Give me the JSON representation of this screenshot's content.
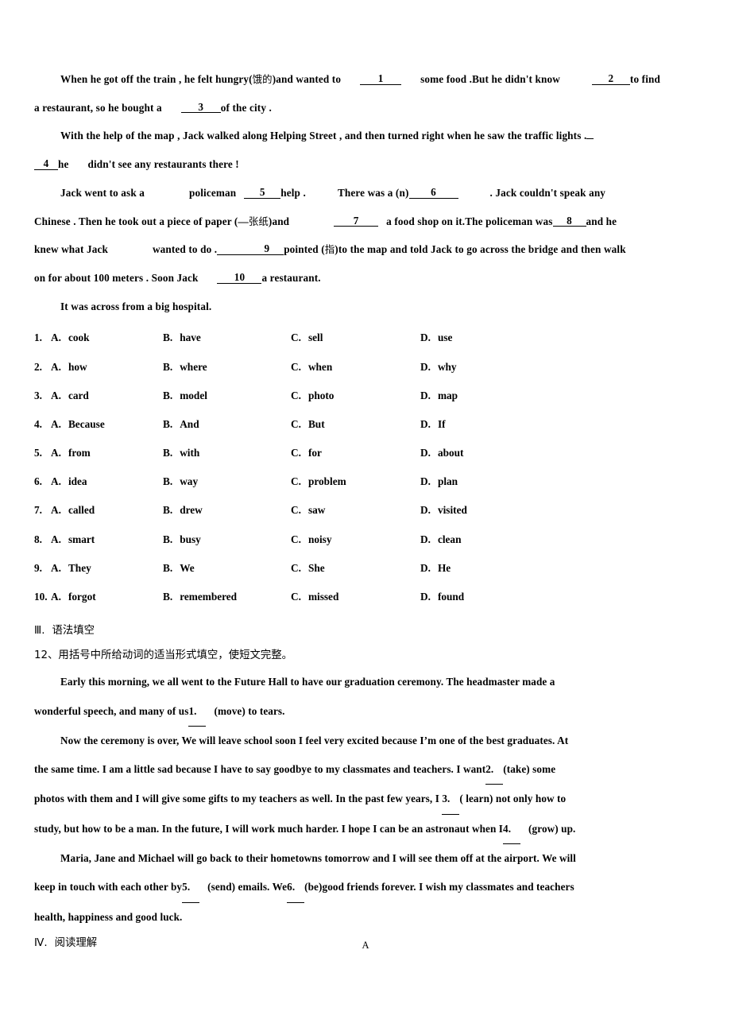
{
  "document": {
    "cloze_passage": {
      "lines": [
        {
          "id": "p1l1",
          "segments": [
            {
              "type": "indent"
            },
            {
              "type": "text",
              "value": "When he got off the train , he felt hungry("
            },
            {
              "type": "cjk",
              "value": "饿的"
            },
            {
              "type": "text",
              "value": ")and wanted to"
            },
            {
              "type": "gap",
              "size": "md"
            },
            {
              "type": "blank",
              "w": "w1",
              "value": "1"
            },
            {
              "type": "gap",
              "size": "md"
            },
            {
              "type": "text",
              "value": "some food .But he didn't know"
            },
            {
              "type": "gap",
              "size": "lg"
            },
            {
              "type": "blank",
              "w": "w2",
              "value": "2"
            },
            {
              "type": "text",
              "value": "to find"
            }
          ]
        },
        {
          "id": "p1l2",
          "segments": [
            {
              "type": "text",
              "value": "a restaurant, so he bought a"
            },
            {
              "type": "gap",
              "size": "md"
            },
            {
              "type": "blank",
              "w": "w3",
              "value": "3"
            },
            {
              "type": "text",
              "value": "of the city ."
            }
          ]
        },
        {
          "id": "p2l1",
          "segments": [
            {
              "type": "indent"
            },
            {
              "type": "text",
              "value": "With the help of the map , Jack walked along Helping Street , and then turned right when he saw the traffic lights ."
            },
            {
              "type": "tinyblank"
            }
          ]
        },
        {
          "id": "p2l2",
          "segments": [
            {
              "type": "blank",
              "w": "w4",
              "value": "4"
            },
            {
              "type": "text",
              "value": "he"
            },
            {
              "type": "gap",
              "size": "md"
            },
            {
              "type": "text",
              "value": "didn't see any restaurants there !"
            }
          ]
        },
        {
          "id": "p3l1",
          "segments": [
            {
              "type": "indent"
            },
            {
              "type": "text",
              "value": "Jack went to ask a"
            },
            {
              "type": "gap",
              "size": "xl"
            },
            {
              "type": "text",
              "value": "policeman"
            },
            {
              "type": "gap",
              "size": "sm"
            },
            {
              "type": "blank",
              "w": "w5",
              "value": "5"
            },
            {
              "type": "text",
              "value": "help ."
            },
            {
              "type": "gap",
              "size": "lg"
            },
            {
              "type": "text",
              "value": "There was a (n)"
            },
            {
              "type": "blank",
              "w": "w6",
              "value": "6"
            },
            {
              "type": "gap",
              "size": "lg"
            },
            {
              "type": "text",
              "value": ". Jack couldn't speak any"
            }
          ]
        },
        {
          "id": "p3l2",
          "segments": [
            {
              "type": "text",
              "value": "Chinese . Then he took out a piece of paper (—"
            },
            {
              "type": "cjk",
              "value": "张纸"
            },
            {
              "type": "text",
              "value": ")and"
            },
            {
              "type": "gap",
              "size": "xl"
            },
            {
              "type": "blank",
              "w": "w7",
              "value": "7"
            },
            {
              "type": "gap",
              "size": "sm"
            },
            {
              "type": "text",
              "value": "a food shop on it.The policeman was"
            },
            {
              "type": "blank",
              "w": "w8",
              "value": "8"
            },
            {
              "type": "text",
              "value": "and he"
            }
          ]
        },
        {
          "id": "p3l3",
          "segments": [
            {
              "type": "text",
              "value": "knew what Jack"
            },
            {
              "type": "gap",
              "size": "xl"
            },
            {
              "type": "text",
              "value": "wanted to do ."
            },
            {
              "type": "blank",
              "w": "w9",
              "value": "9"
            },
            {
              "type": "text",
              "value": "pointed ("
            },
            {
              "type": "cjk",
              "value": "指"
            },
            {
              "type": "text",
              "value": ")to the map and told Jack to go across the bridge and then walk"
            }
          ]
        },
        {
          "id": "p3l4",
          "segments": [
            {
              "type": "text",
              "value": "on for about 100 meters . Soon Jack"
            },
            {
              "type": "gap",
              "size": "md"
            },
            {
              "type": "blank",
              "w": "w10",
              "value": "10"
            },
            {
              "type": "text",
              "value": "a restaurant."
            }
          ]
        },
        {
          "id": "p4l1",
          "segments": [
            {
              "type": "indent"
            },
            {
              "type": "text",
              "value": "It was across from a big hospital."
            }
          ]
        }
      ]
    },
    "choices": [
      {
        "num": "1.",
        "options": [
          {
            "letter": "A.",
            "text": "cook"
          },
          {
            "letter": "B.",
            "text": "have"
          },
          {
            "letter": "C.",
            "text": "sell"
          },
          {
            "letter": "D.",
            "text": "use"
          }
        ]
      },
      {
        "num": "2.",
        "options": [
          {
            "letter": "A.",
            "text": "how"
          },
          {
            "letter": "B.",
            "text": "where"
          },
          {
            "letter": "C.",
            "text": "when"
          },
          {
            "letter": "D.",
            "text": "why"
          }
        ]
      },
      {
        "num": "3.",
        "options": [
          {
            "letter": "A.",
            "text": "card"
          },
          {
            "letter": "B.",
            "text": "model"
          },
          {
            "letter": "C.",
            "text": "photo"
          },
          {
            "letter": "D.",
            "text": "map"
          }
        ]
      },
      {
        "num": "4.",
        "options": [
          {
            "letter": "A.",
            "text": "Because"
          },
          {
            "letter": "B.",
            "text": "And"
          },
          {
            "letter": "C.",
            "text": "But"
          },
          {
            "letter": "D.",
            "text": "If"
          }
        ]
      },
      {
        "num": "5.",
        "options": [
          {
            "letter": "A.",
            "text": "from"
          },
          {
            "letter": "B.",
            "text": "with"
          },
          {
            "letter": "C.",
            "text": "for"
          },
          {
            "letter": "D.",
            "text": "about"
          }
        ]
      },
      {
        "num": "6.",
        "options": [
          {
            "letter": "A.",
            "text": "idea"
          },
          {
            "letter": "B.",
            "text": "way"
          },
          {
            "letter": "C.",
            "text": "problem"
          },
          {
            "letter": "D.",
            "text": "plan"
          }
        ]
      },
      {
        "num": "7.",
        "options": [
          {
            "letter": "A.",
            "text": "called"
          },
          {
            "letter": "B.",
            "text": "drew"
          },
          {
            "letter": "C.",
            "text": "saw"
          },
          {
            "letter": "D.",
            "text": "visited"
          }
        ]
      },
      {
        "num": "8.",
        "options": [
          {
            "letter": "A.",
            "text": "smart"
          },
          {
            "letter": "B.",
            "text": "busy"
          },
          {
            "letter": "C.",
            "text": "noisy"
          },
          {
            "letter": "D.",
            "text": "clean"
          }
        ]
      },
      {
        "num": "9.",
        "options": [
          {
            "letter": "A.",
            "text": "They"
          },
          {
            "letter": "B.",
            "text": "We"
          },
          {
            "letter": "C.",
            "text": "She"
          },
          {
            "letter": "D.",
            "text": "He"
          }
        ]
      },
      {
        "num": "10.",
        "options": [
          {
            "letter": "A.",
            "text": "forgot"
          },
          {
            "letter": "B.",
            "text": "remembered"
          },
          {
            "letter": "C.",
            "text": "missed"
          },
          {
            "letter": "D.",
            "text": "found"
          }
        ]
      }
    ],
    "section_grammar": {
      "roman": "Ⅲ.",
      "title": "语法填空",
      "instruction": "12、用括号中所给动词的适当形式填空，使短文完整。",
      "lines": [
        {
          "id": "g1l1",
          "segments": [
            {
              "type": "indent"
            },
            {
              "type": "text",
              "value": "Early this morning, we all went to the Future Hall to have our graduation ceremony. The headmaster made a"
            }
          ]
        },
        {
          "id": "g1l2",
          "segments": [
            {
              "type": "text",
              "value": "wonderful speech, and many of us"
            },
            {
              "type": "gblank",
              "value": "1."
            },
            {
              "type": "gap",
              "size": "sm"
            },
            {
              "type": "text",
              "value": "(move) to tears."
            }
          ]
        },
        {
          "id": "g2l1",
          "segments": [
            {
              "type": "indent"
            },
            {
              "type": "text",
              "value": "Now the ceremony is over, We will leave school soon I feel very excited because I’m one of the best graduates. At"
            }
          ]
        },
        {
          "id": "g2l2",
          "segments": [
            {
              "type": "text",
              "value": "the same time. I am a little sad because I have to say goodbye to my classmates and teachers. I want"
            },
            {
              "type": "gblank",
              "value": "2."
            },
            {
              "type": "text",
              "value": "(take) some"
            }
          ]
        },
        {
          "id": "g2l3",
          "segments": [
            {
              "type": "text",
              "value": "photos with them and I will give some gifts to my teachers as well. In the past few years, I "
            },
            {
              "type": "gblank",
              "value": "3."
            },
            {
              "type": "text",
              "value": "( learn) not only how to"
            }
          ]
        },
        {
          "id": "g2l4",
          "segments": [
            {
              "type": "text",
              "value": "study, but how to be a man. In the future, I will work much harder. I hope I can be an astronaut when I"
            },
            {
              "type": "gblank",
              "value": "4."
            },
            {
              "type": "gap",
              "size": "sm"
            },
            {
              "type": "text",
              "value": "(grow) up."
            }
          ]
        },
        {
          "id": "g3l1",
          "segments": [
            {
              "type": "indent"
            },
            {
              "type": "text",
              "value": "Maria, Jane and Michael will go back to their hometowns tomorrow and I will see them off at the airport. We will"
            }
          ]
        },
        {
          "id": "g3l2",
          "segments": [
            {
              "type": "text",
              "value": "keep in touch with each other by"
            },
            {
              "type": "gblank",
              "value": "5."
            },
            {
              "type": "gap",
              "size": "sm"
            },
            {
              "type": "text",
              "value": "(send) emails. We"
            },
            {
              "type": "gblank",
              "value": "6."
            },
            {
              "type": "text",
              "value": "(be)good friends forever. I wish my classmates and teachers"
            }
          ]
        },
        {
          "id": "g3l3",
          "segments": [
            {
              "type": "text",
              "value": "health, happiness and good luck."
            }
          ]
        }
      ]
    },
    "section_reading": {
      "roman": "Ⅳ.",
      "title": "阅读理解",
      "passage_label": "A"
    }
  }
}
